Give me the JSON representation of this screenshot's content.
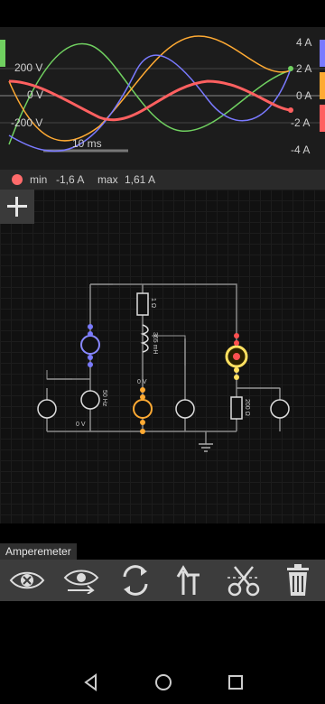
{
  "oscilloscope": {
    "left_axis": [
      "200 V",
      "0 V",
      "-200 V"
    ],
    "right_axis": [
      "4 A",
      "2 A",
      "0 A",
      "-2 A",
      "-4 A"
    ],
    "timescale": "10 ms",
    "series_colors": [
      "#7a7aff",
      "#ffaa33",
      "#ff6060",
      "#70d060"
    ]
  },
  "status": {
    "min_label": "min",
    "min_value": "-1,6 A",
    "max_label": "max",
    "max_value": "1,61 A"
  },
  "circuit": {
    "labels": [
      "1 Ω",
      "365 mH",
      "0 V",
      "50 Hz",
      "0 V",
      "200 Ω"
    ]
  },
  "bottom": {
    "selected_component": "Amperemeter",
    "tools": [
      "hide",
      "show",
      "rotate",
      "swap",
      "cut",
      "delete"
    ]
  },
  "nav": {
    "buttons": [
      "back",
      "home",
      "recents"
    ]
  }
}
